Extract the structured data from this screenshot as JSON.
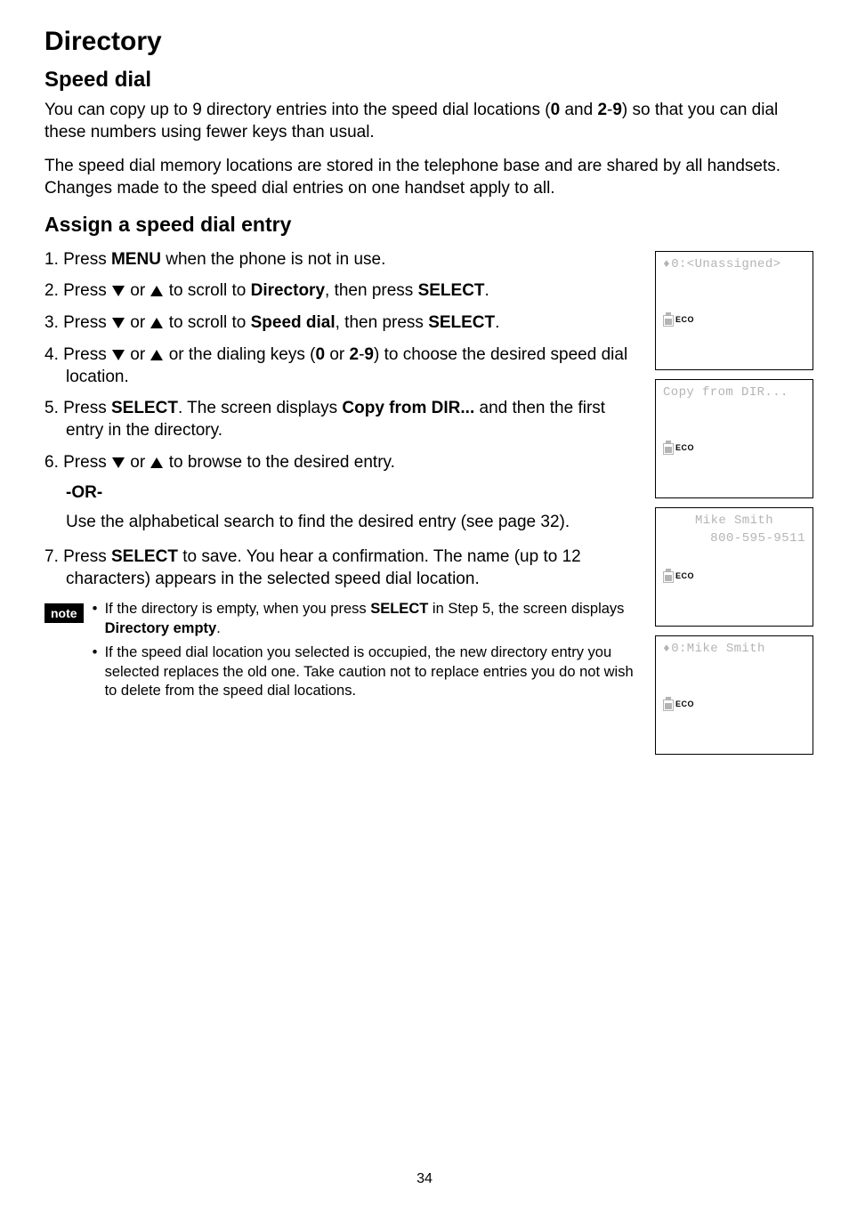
{
  "page_title": "Directory",
  "section_title": "Speed dial",
  "intro_paragraphs": [
    "You can copy up to 9 directory entries into the speed dial locations (0 and 2-9) so that you can dial these numbers using fewer keys than usual.",
    "The speed dial memory locations are stored in the telephone base and are shared by all handsets. Changes made to the speed dial entries on one handset apply to all."
  ],
  "subsection_title": "Assign a speed dial entry",
  "steps": {
    "s1_pre": "1. Press ",
    "s1_menu": "MENU",
    "s1_post": " when the phone is not in use.",
    "s2_pre": "2. Press ",
    "s2_or": " or ",
    "s2_mid": " to scroll to ",
    "s2_dir": "Directory",
    "s2_mid2": ", then press ",
    "s2_select": "SELECT",
    "s2_end": ".",
    "s3_pre": "3. Press ",
    "s3_mid": " to scroll to ",
    "s3_sd": "Speed dial",
    "s3_mid2": ", then press ",
    "s4_pre": "4. Press ",
    "s4_mid": " or the dialing keys (",
    "s4_zero": "0",
    "s4_or2": " or ",
    "s4_range": "2",
    "s4_dash": "-",
    "s4_nine": "9",
    "s4_post": ") to choose the desired speed dial location.",
    "s5_pre": "5. Press ",
    "s5_mid": ". The screen displays ",
    "s5_copy": "Copy from DIR...",
    "s5_post": " and then the first entry in the directory.",
    "s6_pre": "6. Press ",
    "s6_post": " to browse to the desired entry.",
    "or_label": "-OR-",
    "s6_alt": "Use the alphabetical search to find the desired entry (see page 32).",
    "s7_pre": "7. Press ",
    "s7_post": " to save. You hear a confirmation. The name (up to 12 characters) appears in the selected speed dial location."
  },
  "note_badge": "note",
  "notes": {
    "n1_pre": "If the directory is empty, when you press ",
    "n1_select": "SELECT",
    "n1_mid": " in Step 5, the screen displays ",
    "n1_de": "Directory empty",
    "n1_end": ".",
    "n2": "If the speed dial location you selected is occupied, the new directory entry you selected replaces the old one. Take caution not to replace entries you do not wish to delete from the speed dial locations."
  },
  "screens": {
    "s1_line": "0:<Unassigned>",
    "s2_line": "Copy from DIR...",
    "s3_line1": "Mike Smith",
    "s3_line2": "800-595-9511",
    "s4_line": "0:Mike Smith",
    "eco": "ECO"
  },
  "page_number": "34"
}
